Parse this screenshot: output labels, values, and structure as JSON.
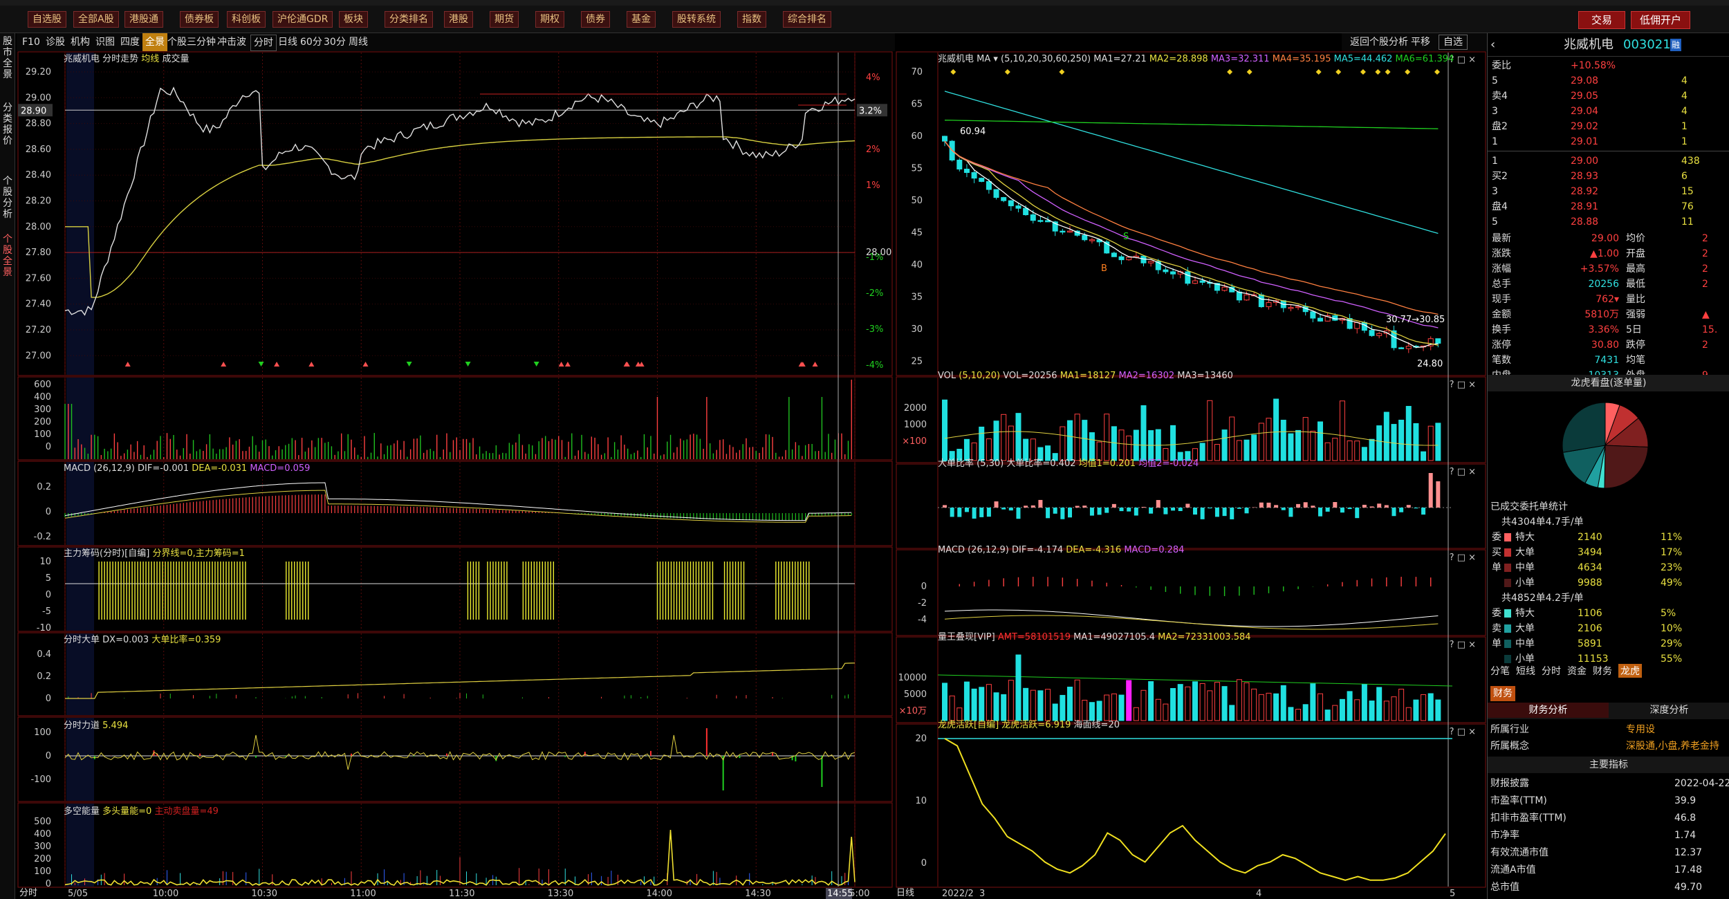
{
  "toolbar": {
    "buttons": [
      "自选股",
      "全部A股",
      "港股通",
      "债券板",
      "科创板",
      "沪伦通GDR",
      "板块",
      "分类排名",
      "港股",
      "期货",
      "期权",
      "债券",
      "基金",
      "股转系统",
      "指数",
      "综合排名"
    ],
    "trade": "交易",
    "open_account": "低佣开户"
  },
  "vtabs": [
    "股市全景",
    "分类报价",
    "个股分析",
    "个股全景"
  ],
  "left_tabs": [
    "F10",
    "诊股",
    "机构",
    "识图",
    "四度",
    "全景",
    "个股三分钟",
    "冲击波"
  ],
  "period_tabs": [
    "分时",
    "日线",
    "60分",
    "30分",
    "周线"
  ],
  "right_tabs": [
    "返回个股分析",
    "平移",
    "自选"
  ],
  "intraday": {
    "title": "兆威机电  分时走势",
    "avg_label": "均线",
    "vol_label": "成交量",
    "price_ticks": [
      "29.20",
      "29.00",
      "28.80",
      "28.60",
      "28.40",
      "28.20",
      "28.00",
      "27.80",
      "27.60",
      "27.40",
      "27.20",
      "27.00"
    ],
    "pct_ticks": [
      "4%",
      "3%",
      "2%",
      "1%",
      "",
      "-1%",
      "-2%",
      "-3%",
      "-4%"
    ],
    "current_price": "28.90",
    "current_pct": "3.2%",
    "base": "28.00",
    "vol_ticks": [
      "600",
      "400",
      "300",
      "200",
      "100",
      "0"
    ],
    "time_ticks": [
      "5/05",
      "10:00",
      "10:30",
      "11:00",
      "11:30",
      "13:30",
      "14:00",
      "14:30",
      "15:00"
    ],
    "cursor_time": "14:55",
    "footer_left": "分时"
  },
  "macd_left": {
    "title": "MACD",
    "params": "(26,12,9)",
    "dif": "DIF=-0.001",
    "dea": "DEA=-0.031",
    "macd": "MACD=0.059",
    "ticks": [
      "0.2",
      "0",
      "-0.2"
    ]
  },
  "zhuli": {
    "title": "主力筹码(分时)",
    "sub": "[自编]",
    "text": "分界线=0,主力筹码=1",
    "ticks": [
      "10",
      "5",
      "0",
      "-5",
      "-10"
    ]
  },
  "dadan": {
    "title": "分时大单",
    "dx": "DX=0.003",
    "ratio": "大单比率=0.359",
    "ticks": [
      "0.4",
      "0.2",
      "0"
    ]
  },
  "lidao": {
    "title": "分时力道",
    "value": "5.494",
    "ticks": [
      "100",
      "0",
      "-100"
    ]
  },
  "duokong": {
    "title": "多空能量",
    "a": "多头量能=0",
    "b": "主动卖盘量=49",
    "ticks": [
      "500",
      "400",
      "300",
      "200",
      "100",
      "0"
    ]
  },
  "kline": {
    "name": "兆威机电",
    "ma_params": "MA ▾ (5,10,20,30,60,250)",
    "ma1": "MA1=27.21",
    "ma2": "MA2=28.898",
    "ma3": "MA3=32.311",
    "ma4": "MA4=35.195",
    "ma5": "MA5=44.462",
    "ma6": "MA6=61.394",
    "ticks": [
      "70",
      "65",
      "60",
      "55",
      "50",
      "45",
      "40",
      "35",
      "30",
      "25"
    ],
    "high_label": "60.94",
    "range_label": "30.77→30.85",
    "low_label": "24.80",
    "b_label": "B",
    "s_label": "S"
  },
  "vol_right": {
    "title": "VOL",
    "params": "(5,10,20)",
    "vol": "VOL=20256",
    "ma1": "MA1=18127",
    "ma2": "MA2=16302",
    "ma3": "MA3=13460",
    "ticks": [
      "2000",
      "1000",
      "×100"
    ]
  },
  "dadanbi": {
    "title": "大单比率",
    "params": "(5,30)",
    "ratio": "大单比率=0.402",
    "j1": "均值1=0.201",
    "j2": "均值2=-0.024"
  },
  "macd_right": {
    "title": "MACD",
    "params": "(26,12,9)",
    "dif": "DIF=-4.174",
    "dea": "DEA=-4.316",
    "macd": "MACD=0.284",
    "ticks": [
      "0",
      "-2",
      "-4"
    ]
  },
  "liangwang": {
    "title": "量王叠现[VIP]",
    "amt": "AMT=58101519",
    "ma1": "MA1=49027105.4",
    "ma2": "MA2=72331003.584",
    "ticks": [
      "10000",
      "5000",
      "×10万"
    ]
  },
  "longhu": {
    "title": "龙虎活跃[自编]",
    "v": "龙虎活跃=6.919",
    "sea": "海面线=20",
    "ticks": [
      "20",
      "10",
      "0"
    ]
  },
  "date_axis": {
    "left": "日线",
    "ticks": [
      "2022/2",
      "3",
      "4",
      "5"
    ]
  },
  "quote": {
    "name": "兆威机电",
    "code": "003021",
    "badge": "融",
    "weibi_label": "委比",
    "weibi": "+10.58%",
    "asks": [
      {
        "l": "5",
        "p": "29.08",
        "v": "4"
      },
      {
        "l": "卖4",
        "p": "29.05",
        "v": "4"
      },
      {
        "l": "3",
        "p": "29.04",
        "v": "4"
      },
      {
        "l": "盘2",
        "p": "29.02",
        "v": "1"
      },
      {
        "l": "1",
        "p": "29.01",
        "v": "1"
      }
    ],
    "bids": [
      {
        "l": "1",
        "p": "29.00",
        "v": "438"
      },
      {
        "l": "买2",
        "p": "28.93",
        "v": "6"
      },
      {
        "l": "3",
        "p": "28.92",
        "v": "15"
      },
      {
        "l": "盘4",
        "p": "28.91",
        "v": "76"
      },
      {
        "l": "5",
        "p": "28.88",
        "v": "11"
      }
    ],
    "stats": [
      {
        "a": "最新",
        "b": "29.00",
        "c": "均价",
        "d": "2"
      },
      {
        "a": "涨跌",
        "b": "▲1.00",
        "c": "开盘",
        "d": "2"
      },
      {
        "a": "涨幅",
        "b": "+3.57%",
        "c": "最高",
        "d": "2"
      },
      {
        "a": "总手",
        "b": "20256",
        "c": "最低",
        "d": "2"
      },
      {
        "a": "现手",
        "b": "762▾",
        "c": "量比",
        "d": ""
      },
      {
        "a": "金额",
        "b": "5810万",
        "c": "强弱",
        "d": "▲"
      },
      {
        "a": "换手",
        "b": "3.36%",
        "c": "5日",
        "d": "15."
      },
      {
        "a": "涨停",
        "b": "30.80",
        "c": "跌停",
        "d": "2"
      },
      {
        "a": "笔数",
        "b": "7431",
        "c": "均笔",
        "d": ""
      },
      {
        "a": "内盘",
        "b": "10313",
        "c": "外盘",
        "d": "9"
      }
    ]
  },
  "longhu_panel": {
    "title": "龙虎看盘(逐单量)",
    "done": "已成交委托单统计",
    "buy_total": "共4304单4.7手/单",
    "buy": [
      {
        "s": "委",
        "n": "特大",
        "v": "2140",
        "p": "11%"
      },
      {
        "s": "买",
        "n": "大单",
        "v": "3494",
        "p": "17%"
      },
      {
        "s": "单",
        "n": "中单",
        "v": "4634",
        "p": "23%"
      },
      {
        "s": "",
        "n": "小单",
        "v": "9988",
        "p": "49%"
      }
    ],
    "sell_total": "共4852单4.2手/单",
    "sell": [
      {
        "s": "委",
        "n": "特大",
        "v": "1106",
        "p": "5%"
      },
      {
        "s": "卖",
        "n": "大单",
        "v": "2106",
        "p": "10%"
      },
      {
        "s": "单",
        "n": "中单",
        "v": "5891",
        "p": "29%"
      },
      {
        "s": "",
        "n": "小单",
        "v": "11153",
        "p": "55%"
      }
    ],
    "pie": [
      {
        "v": 11,
        "c": "#ff6060"
      },
      {
        "v": 17,
        "c": "#c03030"
      },
      {
        "v": 23,
        "c": "#802020"
      },
      {
        "v": 49,
        "c": "#501818"
      },
      {
        "v": 5,
        "c": "#40e0d0"
      },
      {
        "v": 10,
        "c": "#20a0a0"
      },
      {
        "v": 29,
        "c": "#106060"
      },
      {
        "v": 55,
        "c": "#0a3a3a"
      }
    ]
  },
  "bottom_tabs": [
    "分笔",
    "短线",
    "分时",
    "资金",
    "财务",
    "龙虎"
  ],
  "finance": {
    "tab": "财务",
    "tab1": "财务分析",
    "tab2": "深度分析",
    "rows": [
      {
        "k": "所属行业",
        "v": "专用设"
      },
      {
        "k": "所属概念",
        "v": "深股通,小盘,养老金持"
      }
    ],
    "main": "主要指标",
    "metrics": [
      {
        "k": "财报披露",
        "v": "2022-04-22"
      },
      {
        "k": "市盈率(TTM)",
        "v": "39.9"
      },
      {
        "k": "扣非市盈率(TTM)",
        "v": "46.8"
      },
      {
        "k": "市净率",
        "v": "1.74"
      },
      {
        "k": "有效流通市值",
        "v": "12.37"
      },
      {
        "k": "流通A市值",
        "v": "17.48"
      },
      {
        "k": "总市值",
        "v": "49.70"
      }
    ]
  }
}
